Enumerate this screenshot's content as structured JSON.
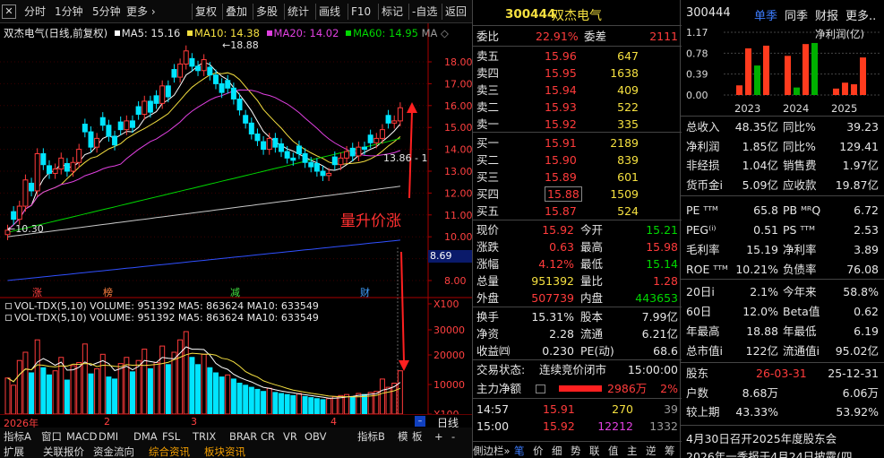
{
  "toolbar": {
    "items": [
      "分时",
      "1分钟",
      "5分钟",
      "更多",
      "复权",
      "叠加",
      "多股",
      "统计",
      "画线",
      "F10",
      "标记",
      "-自选",
      "返回"
    ],
    "more_arrow": "›"
  },
  "chart_header": {
    "title": "双杰电气(日线,前复权)",
    "ma5": "MA5: 15.16",
    "ma10": "MA10: 14.38",
    "ma20": "MA20: 14.02",
    "ma60": "MA60: 14.95",
    "ma_more": "MA ◇"
  },
  "price_axis": [
    "18.00",
    "17.00",
    "16.00",
    "15.00",
    "14.00",
    "13.00",
    "12.00",
    "11.00",
    "10.00",
    "9.00",
    "8.00"
  ],
  "price_marker": "8.69",
  "annotations": {
    "high": "18.88",
    "low": "10.30",
    "last": "13.86 - 1",
    "text": "量升价涨"
  },
  "event_tags": [
    "涨",
    "榜",
    "减",
    "财"
  ],
  "volume_header": [
    "VOL-TDX(5,10) VOLUME: 951392 MA5: 863624 MA10: 633549",
    "VOL-TDX(5,10) VOLUME: 951392 MA5: 863624 MA10: 633549"
  ],
  "volume_axis": [
    "X100",
    "30000",
    "20000",
    "10000",
    "X100"
  ],
  "date_axis": {
    "year": "2026年",
    "months": [
      "2",
      "3",
      "4"
    ],
    "label": "日线"
  },
  "bottom_tabs_row1": [
    "指标A",
    "窗口",
    "MACD",
    "DMI",
    "DMA",
    "FSL",
    "TRIX",
    "BRAR",
    "CR",
    "VR",
    "OBV",
    "指标B",
    "模",
    "板",
    "+",
    "-"
  ],
  "bottom_tabs_row2": [
    "扩展",
    "关联报价",
    "资金流向",
    "综合资讯",
    "板块资讯"
  ],
  "quote": {
    "code": "300444",
    "name": "双杰电气",
    "weibi_label": "委比",
    "weibi": "22.91%",
    "weicha_label": "委差",
    "weicha": "2111",
    "asks": [
      {
        "label": "卖五",
        "price": "15.96",
        "vol": "647"
      },
      {
        "label": "卖四",
        "price": "15.95",
        "vol": "1638"
      },
      {
        "label": "卖三",
        "price": "15.94",
        "vol": "409"
      },
      {
        "label": "卖二",
        "price": "15.93",
        "vol": "522"
      },
      {
        "label": "卖一",
        "price": "15.92",
        "vol": "335"
      }
    ],
    "bids": [
      {
        "label": "买一",
        "price": "15.91",
        "vol": "2189"
      },
      {
        "label": "买二",
        "price": "15.90",
        "vol": "839"
      },
      {
        "label": "买三",
        "price": "15.89",
        "vol": "601"
      },
      {
        "label": "买四",
        "price": "15.88",
        "vol": "1509"
      },
      {
        "label": "买五",
        "price": "15.87",
        "vol": "524"
      }
    ],
    "stats": [
      {
        "l1": "现价",
        "v1": "15.92",
        "l2": "今开",
        "v2": "15.21",
        "c1": "red",
        "c2": "green"
      },
      {
        "l1": "涨跌",
        "v1": "0.63",
        "l2": "最高",
        "v2": "15.98",
        "c1": "red",
        "c2": "red"
      },
      {
        "l1": "涨幅",
        "v1": "4.12%",
        "l2": "最低",
        "v2": "15.14",
        "c1": "red",
        "c2": "green"
      },
      {
        "l1": "总量",
        "v1": "951392",
        "l2": "量比",
        "v2": "1.28",
        "c1": "yellow",
        "c2": "red"
      },
      {
        "l1": "外盘",
        "v1": "507739",
        "l2": "内盘",
        "v2": "443653",
        "c1": "red",
        "c2": "green"
      }
    ],
    "stats2": [
      {
        "l1": "换手",
        "v1": "15.31%",
        "l2": "股本",
        "v2": "7.99亿"
      },
      {
        "l1": "净资",
        "v1": "2.28",
        "l2": "流通",
        "v2": "6.21亿"
      },
      {
        "l1": "收益㈣",
        "v1": "0.230",
        "l2": "PE(动)",
        "v2": "68.6"
      }
    ],
    "trade_state_label": "交易状态:",
    "trade_state": "连续竞价闭市",
    "trade_time": "15:00:00",
    "net_label": "主力净额",
    "net_value": "2986万",
    "net_pct": "2%",
    "ticks": [
      {
        "time": "14:57",
        "price": "15.91",
        "vol": "270",
        "num": "39"
      },
      {
        "time": "15:00",
        "price": "15.92",
        "vol": "12212",
        "num": "1332"
      }
    ],
    "bottom_tabs": [
      "側边栏»",
      "笔",
      "价",
      "细",
      "势",
      "联",
      "值",
      "主",
      "逆",
      "筹"
    ]
  },
  "fin": {
    "code": "300444",
    "tabs": [
      "单季",
      "同季",
      "财报",
      "更多.."
    ],
    "chart_title": "净利润(亿)",
    "chart_data": {
      "type": "bar",
      "ylim": [
        0,
        1.17
      ],
      "yticks": [
        "1.17",
        "0.78",
        "0.39",
        "0.00"
      ],
      "categories": [
        "2023",
        "2024",
        "2025"
      ],
      "values": [
        0.18,
        0.87,
        0.55,
        0.92,
        0.73,
        0.14,
        0.95,
        0.97,
        0.12,
        0.23,
        0.2,
        0.7
      ],
      "colors": [
        "#ff3b1e",
        "#ff3b1e",
        "#00b000",
        "#ff3b1e",
        "#ff3b1e",
        "#00b000",
        "#ff3b1e",
        "#00b000",
        "#ff3b1e",
        "#ff3b1e",
        "#ff3b1e",
        "#ff3b1e"
      ]
    },
    "rows": [
      {
        "l1": "总收入",
        "v1": "48.35亿",
        "l2": "同比%",
        "v2": "39.23"
      },
      {
        "l1": "净利润",
        "v1": "1.85亿",
        "l2": "同比%",
        "v2": "129.41"
      },
      {
        "l1": "非经损",
        "v1": "1.04亿",
        "l2": "销售费",
        "v2": "1.97亿"
      },
      {
        "l1": "货币金i",
        "v1": "5.09亿",
        "l2": "应收款",
        "v2": "19.87亿"
      }
    ],
    "rows2": [
      {
        "l1": "PE ᵀᵀᴹ",
        "v1": "65.8",
        "l2": "PB ᴹᴿQ",
        "v2": "6.72"
      },
      {
        "l1": "PEG⁽ⁱ⁾",
        "v1": "0.51",
        "l2": "PS ᵀᵀᴹ",
        "v2": "2.53"
      },
      {
        "l1": "毛利率",
        "v1": "15.19",
        "l2": "净利率",
        "v2": "3.89"
      },
      {
        "l1": "ROE ᵀᵀᴹ",
        "v1": "10.21%",
        "l2": "负债率",
        "v2": "76.08"
      }
    ],
    "rows3": [
      {
        "l1": "20日i",
        "v1": "2.1%",
        "l2": "今年来",
        "v2": "58.8%"
      },
      {
        "l1": "60日",
        "v1": "12.0%",
        "l2": "Beta值",
        "v2": "0.62"
      },
      {
        "l1": "年最高",
        "v1": "18.88",
        "l2": "年最低",
        "v2": "6.19"
      },
      {
        "l1": "总市值i",
        "v1": "122亿",
        "l2": "流通值i",
        "v2": "95.02亿"
      }
    ],
    "holder": {
      "label": "股东",
      "d1": "26-03-31",
      "d2": "25-12-31"
    },
    "holder_rows": [
      {
        "l": "户数",
        "v1": "8.68万",
        "v2": "6.06万"
      },
      {
        "l": "较上期",
        "v1": "43.33%",
        "v2": "53.92%"
      }
    ],
    "news": [
      "4月30日召开2025年度股东会",
      "2026年一季报于4月24日披露(四"
    ]
  },
  "colors": {
    "up": "#ff3b3b",
    "down": "#00e5ff",
    "ma5": "#ffffff",
    "ma10": "#f5e040",
    "ma20": "#e040e0",
    "ma60": "#00d800",
    "ma120": "#c8c8c8",
    "ma250": "#3050ff"
  }
}
